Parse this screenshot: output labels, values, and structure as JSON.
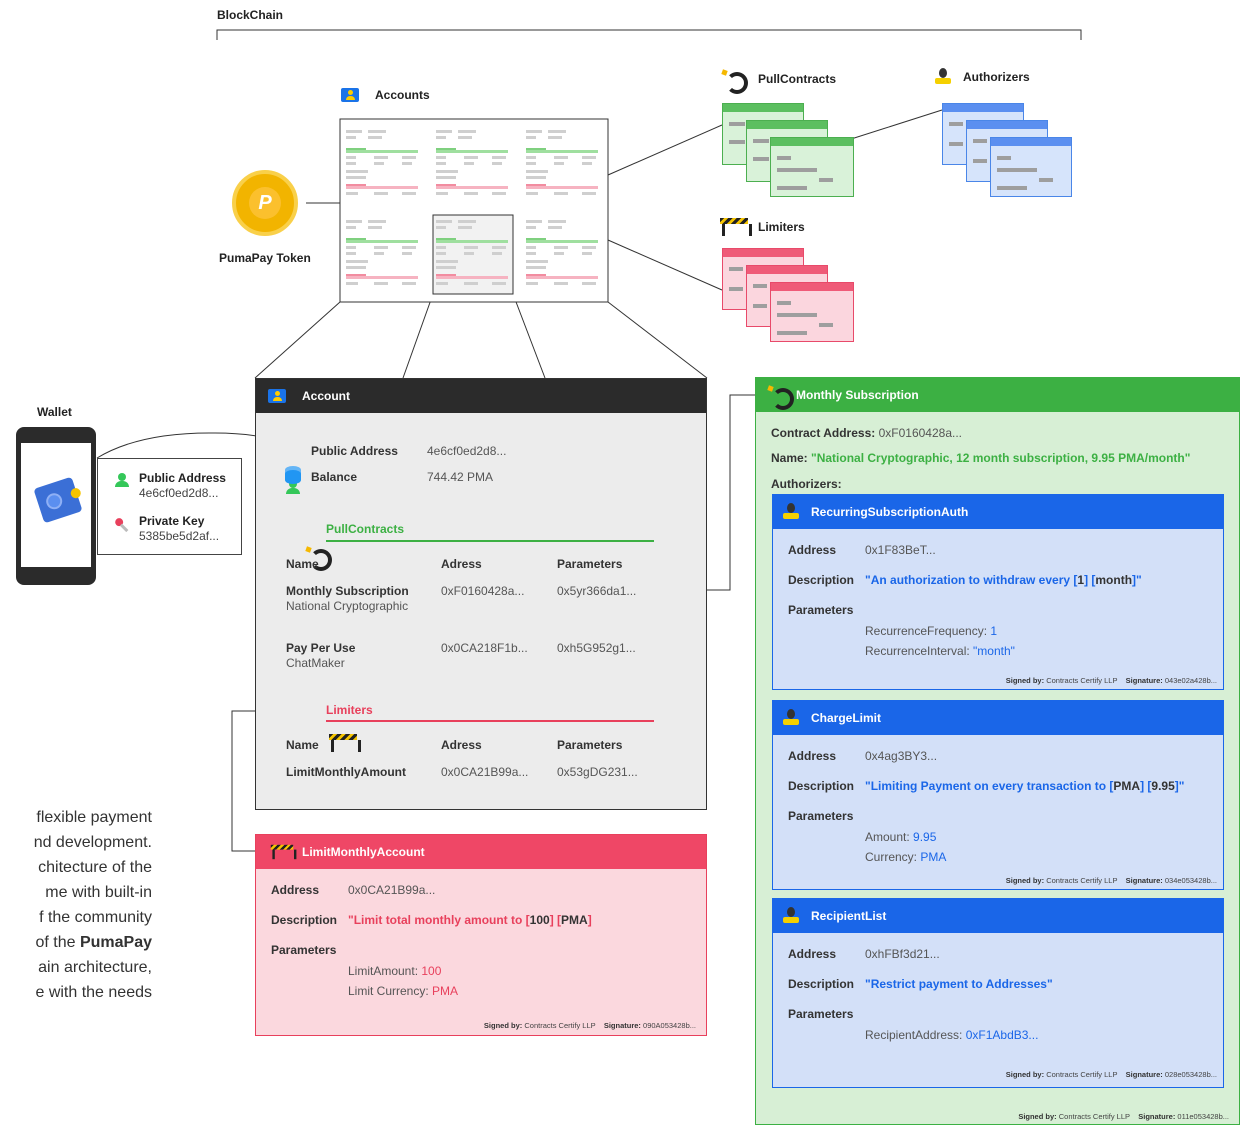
{
  "blockchain_label": "BlockChain",
  "accounts_label": "Accounts",
  "pullcontracts_label": "PullContracts",
  "authorizers_label": "Authorizers",
  "limiters_label": "Limiters",
  "token_label": "PumaPay Token",
  "wallet": {
    "label": "Wallet",
    "public_address_label": "Public Address",
    "public_address_value": "4e6cf0ed2d8...",
    "private_key_label": "Private Key",
    "private_key_value": "5385be5d2af..."
  },
  "account": {
    "title": "Account",
    "public_address_label": "Public Address",
    "public_address_value": "4e6cf0ed2d8...",
    "balance_label": "Balance",
    "balance_value": "744.42 PMA",
    "pull_title": "PullContracts",
    "col_name": "Name",
    "col_adress": "Adress",
    "col_parameters": "Parameters",
    "pull_rows": [
      {
        "name": "Monthly Subscription",
        "sub": "National Cryptographic",
        "adress": "0xF0160428a...",
        "params": "0x5yr366da1..."
      },
      {
        "name": "Pay Per Use",
        "sub": "ChatMaker",
        "adress": "0x0CA218F1b...",
        "params": "0xh5G952g1..."
      }
    ],
    "limiters_title": "Limiters",
    "lim_rows": [
      {
        "name": "LimitMonthlyAmount",
        "adress": "0x0CA21B99a...",
        "params": "0x53gDG231..."
      }
    ]
  },
  "limit_panel": {
    "title": "LimitMonthlyAccount",
    "address_label": "Address",
    "address_value": "0x0CA21B99a...",
    "description_label": "Description",
    "desc_1": "\"Limit total monthly amount to [",
    "desc_2": "100",
    "desc_3": "] [",
    "desc_4": "PMA",
    "desc_5": "]",
    "parameters_label": "Parameters",
    "p1_label": "LimitAmount: ",
    "p1_value": "100",
    "p2_label": "Limit Currency: ",
    "p2_value": "PMA",
    "signed_label": "Signed by:",
    "signed_value": "Contracts Certify LLP",
    "signature_label": "Signature:",
    "signature_value": "090A053428b..."
  },
  "monthly": {
    "title": "Monthly Subscription",
    "contract_label": "Contract Address:",
    "contract_value": "0xF0160428a...",
    "name_label": "Name:",
    "name_value": "\"National Cryptographic, 12 month subscription, 9.95 PMA/month\"",
    "authorizers_label": "Authorizers:",
    "signed_label": "Signed by:",
    "signed_value": "Contracts Certify LLP",
    "signature_label": "Signature:",
    "signature_value": "011e053428b...",
    "auth": [
      {
        "title": "RecurringSubscriptionAuth",
        "address_label": "Address",
        "address_value": "0x1F83BeT...",
        "description_label": "Description",
        "desc_1": "\"An authorization to withdraw every [",
        "desc_2": "1",
        "desc_3": "] [",
        "desc_4": "month",
        "desc_5": "]\"",
        "parameters_label": "Parameters",
        "p1_label": "RecurrenceFrequency: ",
        "p1_value": "1",
        "p2_label": "RecurrenceInterval: ",
        "p2_value": "\"month\"",
        "signed_label": "Signed by:",
        "signed_value": "Contracts Certify LLP",
        "signature_label": "Signature:",
        "signature_value": "043e02a428b..."
      },
      {
        "title": "ChargeLimit",
        "address_label": "Address",
        "address_value": "0x4ag3BY3...",
        "description_label": "Description",
        "desc_1": "\"Limiting Payment on every transaction to [",
        "desc_2": "PMA",
        "desc_3": "] [",
        "desc_4": "9.95",
        "desc_5": "]\"",
        "parameters_label": "Parameters",
        "p1_label": "Amount: ",
        "p1_value": "9.95",
        "p2_label": "Currency: ",
        "p2_value": "PMA",
        "signed_label": "Signed by:",
        "signed_value": "Contracts Certify LLP",
        "signature_label": "Signature:",
        "signature_value": "034e053428b..."
      },
      {
        "title": "RecipientList",
        "address_label": "Address",
        "address_value": "0xhFBf3d21...",
        "description_label": "Description",
        "desc_1": "\"Restrict payment to Addresses\"",
        "parameters_label": "Parameters",
        "p1_label": "RecipientAddress: ",
        "p1_value": "0xF1AbdB3...",
        "signed_label": "Signed by:",
        "signed_value": "Contracts Certify LLP",
        "signature_label": "Signature:",
        "signature_value": "028e053428b..."
      }
    ]
  },
  "body_text": [
    "flexible payment",
    "nd development.",
    "chitecture of the",
    "me with built-in",
    "f the community",
    "of the ",
    "PumaPay",
    "ain architecture,",
    "e with the needs"
  ]
}
